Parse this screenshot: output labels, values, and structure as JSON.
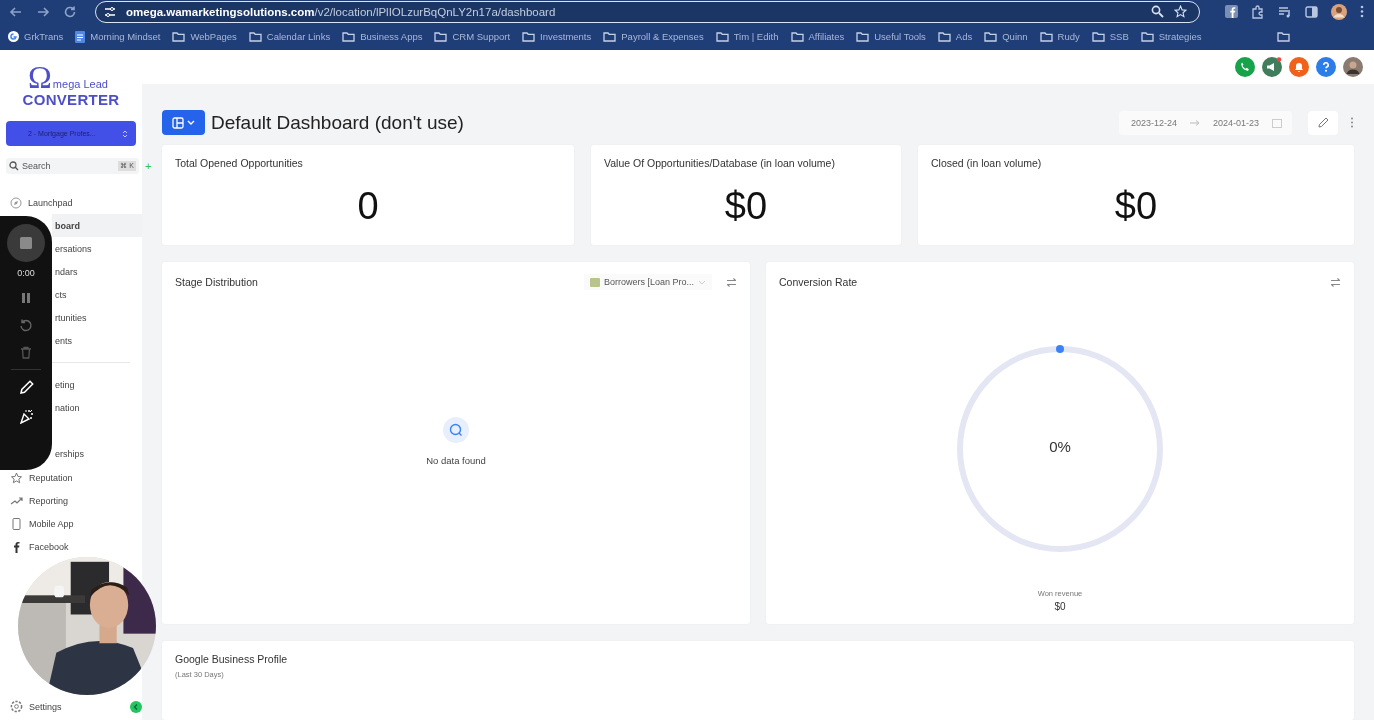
{
  "browser": {
    "url_host": "omega.wamarketingsolutions.com",
    "url_path": "/v2/location/lPlIOLzurBqQnLY2n17a/dashboard",
    "bookmarks": [
      {
        "label": "GrkTrans",
        "kind": "google"
      },
      {
        "label": "Morning Mindset",
        "kind": "doc"
      },
      {
        "label": "WebPages",
        "kind": "folder"
      },
      {
        "label": "Calendar Links",
        "kind": "folder"
      },
      {
        "label": "Business Apps",
        "kind": "folder"
      },
      {
        "label": "CRM Support",
        "kind": "folder"
      },
      {
        "label": "Investments",
        "kind": "folder"
      },
      {
        "label": "Payroll & Expenses",
        "kind": "folder"
      },
      {
        "label": "Tim | Edith",
        "kind": "folder"
      },
      {
        "label": "Affiliates",
        "kind": "folder"
      },
      {
        "label": "Useful Tools",
        "kind": "folder"
      },
      {
        "label": "Ads",
        "kind": "folder"
      },
      {
        "label": "Quinn",
        "kind": "folder"
      },
      {
        "label": "Rudy",
        "kind": "folder"
      },
      {
        "label": "SSB",
        "kind": "folder"
      },
      {
        "label": "Strategies",
        "kind": "folder"
      }
    ]
  },
  "sidebar": {
    "logo_mark": "Ω",
    "logo_top": "mega Lead",
    "logo_bottom": "CONVERTER",
    "location": "2 - Mortgage Profes...",
    "search": {
      "placeholder": "Search",
      "shortcut": "⌘ K",
      "add": "+"
    },
    "items": [
      {
        "label": "Launchpad",
        "selected": false
      },
      {
        "label": "board",
        "selected": true
      },
      {
        "label": "ersations",
        "selected": false
      },
      {
        "label": "ndars",
        "selected": false
      },
      {
        "label": "cts",
        "selected": false
      },
      {
        "label": "rtunities",
        "selected": false
      },
      {
        "label": "ents",
        "selected": false
      }
    ],
    "items2": [
      {
        "label": "eting"
      },
      {
        "label": "nation"
      },
      {
        "label": "erships"
      }
    ],
    "items3": [
      {
        "label": "Reputation"
      },
      {
        "label": "Reporting"
      },
      {
        "label": "Mobile App"
      },
      {
        "label": "Facebook"
      }
    ],
    "settings": "Settings"
  },
  "recorder": {
    "time": "0:00"
  },
  "dashboard": {
    "title": "Default Dashboard (don't use)",
    "date_from": "2023-12-24",
    "date_to": "2024-01-23",
    "stats": [
      {
        "title": "Total Opened Opportunities",
        "value": "0"
      },
      {
        "title": "Value Of Opportunities/Database (in loan volume)",
        "value": "$0"
      },
      {
        "title": "Closed (in loan volume)",
        "value": "$0"
      }
    ],
    "stage": {
      "title": "Stage Distribution",
      "pipeline": "Borrowers [Loan Pro...",
      "empty": "No data found"
    },
    "conversion": {
      "title": "Conversion Rate",
      "percent": "0%",
      "level": 0,
      "caption": "Won revenue",
      "revenue": "$0"
    },
    "gbp": {
      "title": "Google Business Profile",
      "subtitle": "(Last 30 Days)"
    }
  }
}
